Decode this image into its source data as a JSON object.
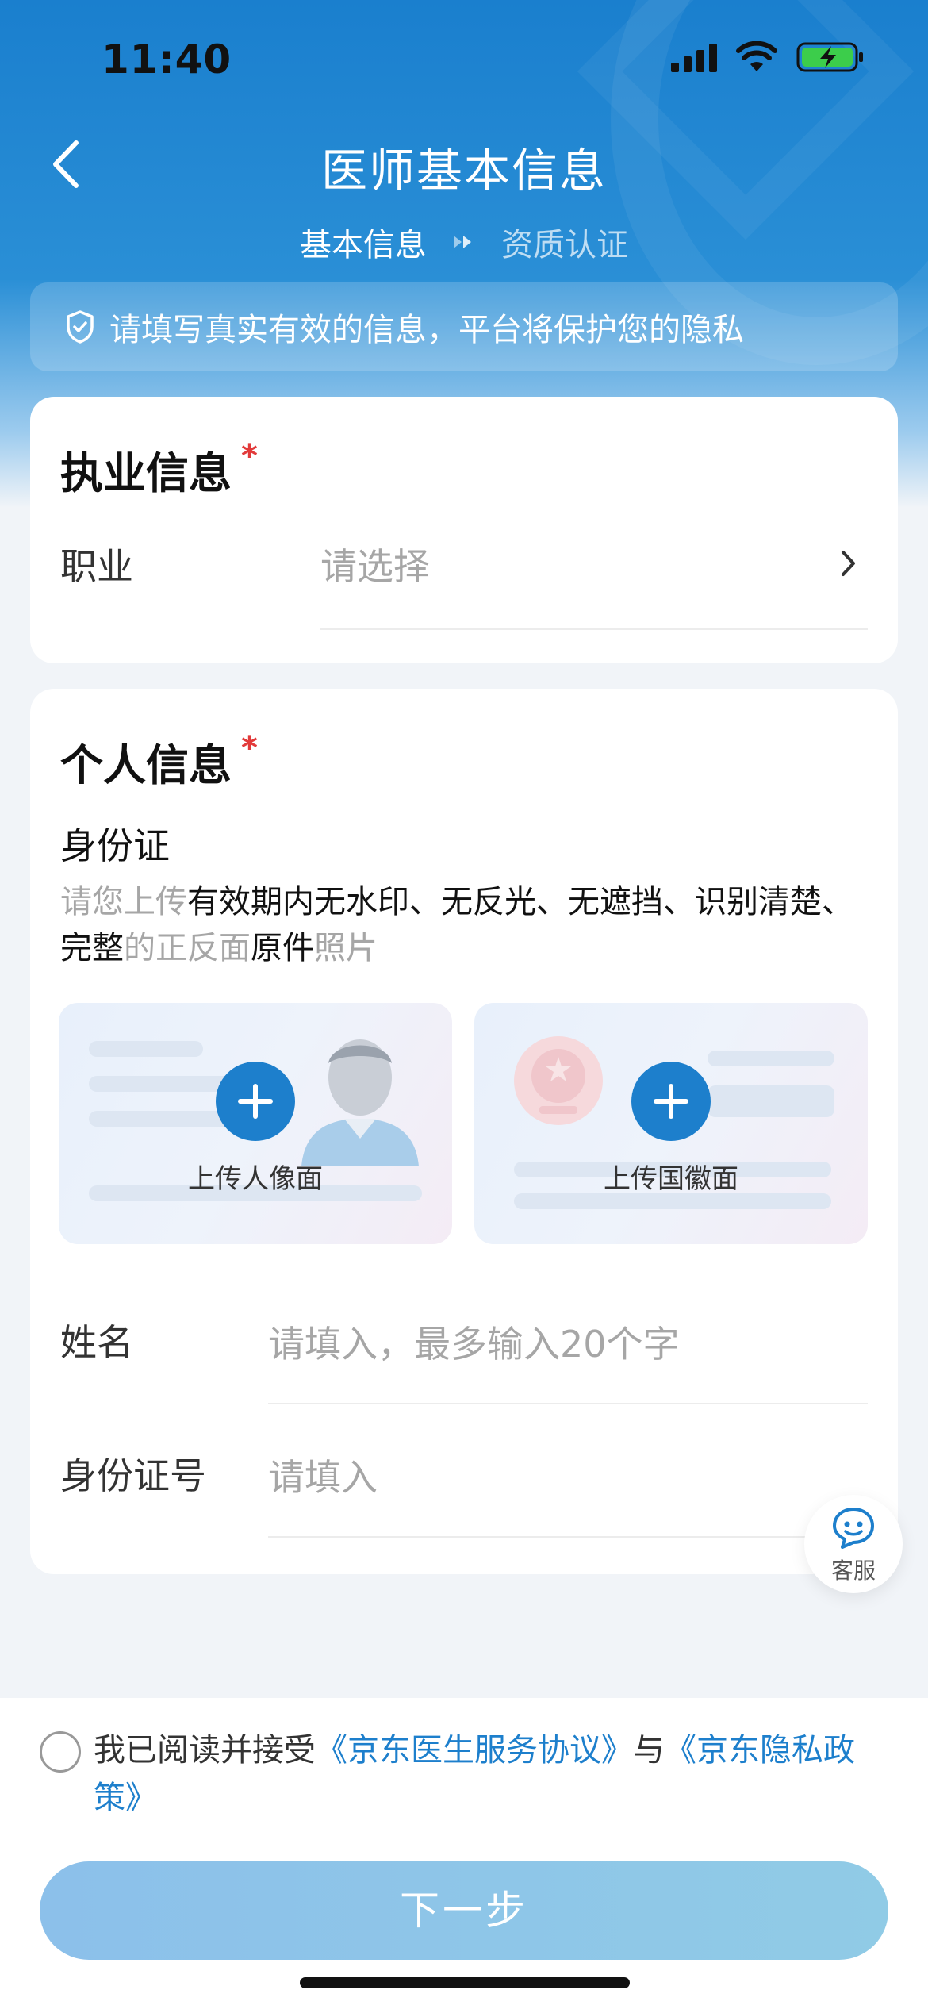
{
  "status_bar": {
    "time": "11:40"
  },
  "nav": {
    "title": "医师基本信息"
  },
  "steps": {
    "current": "基本信息",
    "next": "资质认证"
  },
  "notice": {
    "text": "请填写真实有效的信息，平台将保护您的隐私"
  },
  "practice_section": {
    "title": "执业信息",
    "required_mark": "*",
    "occupation_label": "职业",
    "occupation_placeholder": "请选择"
  },
  "personal_section": {
    "title": "个人信息",
    "required_mark": "*",
    "id_card_title": "身份证",
    "hint": {
      "p1": "请您上传",
      "p2": "有效期内无水印、无反光、无遮挡、识别清楚、完整",
      "p3": "的正反面",
      "p4": "原件",
      "p5": "照片"
    },
    "upload_portrait": "上传人像面",
    "upload_emblem": "上传国徽面",
    "name_label": "姓名",
    "name_placeholder": "请填入，最多输入20个字",
    "id_label": "身份证号",
    "id_placeholder": "请填入"
  },
  "customer_service": {
    "label": "客服"
  },
  "agreement": {
    "prefix": "我已阅读并接受",
    "link1": "《京东医生服务协议》",
    "and": "与",
    "link2": "《京东隐私政策》"
  },
  "buttons": {
    "next": "下一步"
  },
  "colors": {
    "primary": "#1d7fcc",
    "required": "#e23a3a",
    "placeholder": "#a6a6a6"
  }
}
